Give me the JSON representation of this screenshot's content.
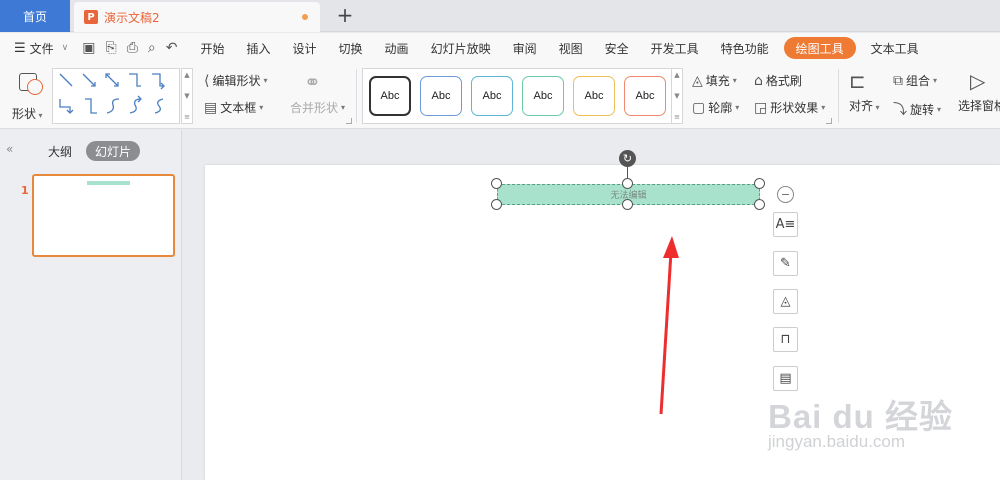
{
  "tabs": {
    "home": "首页",
    "doc_logo": "P",
    "doc_name": "演示文稿2",
    "new_tab": "+"
  },
  "menu": {
    "file": "文件",
    "items": [
      "开始",
      "插入",
      "设计",
      "切换",
      "动画",
      "幻灯片放映",
      "审阅",
      "视图",
      "安全",
      "开发工具",
      "特色功能",
      "绘图工具",
      "文本工具"
    ],
    "active_item": "绘图工具",
    "accent_color": "#ee7a34"
  },
  "ribbon": {
    "shape": "形状",
    "edit_shape": "编辑形状",
    "text_box": "文本框",
    "merge_shape": "合并形状",
    "style_samples": [
      "Abc",
      "Abc",
      "Abc",
      "Abc",
      "Abc",
      "Abc"
    ],
    "style_colors": [
      "#333333",
      "#6f9ad8",
      "#5fb6d8",
      "#6cc9a6",
      "#f0bf5a",
      "#ef8a70"
    ],
    "fill": "填充",
    "format_painter": "格式刷",
    "outline": "轮廓",
    "shape_effect": "形状效果",
    "align": "对齐",
    "group": "组合",
    "rotate": "旋转",
    "selection_pane": "选择窗格"
  },
  "left_panel": {
    "collapse": "«",
    "tab_outline": "大纲",
    "tab_slides": "幻灯片",
    "slide_number": "1"
  },
  "canvas": {
    "shape_text": "无法编辑",
    "shape_fill": "#a8e2cc",
    "annotation_color": "#ee2e2e"
  },
  "side_tools": [
    "text-style-icon",
    "brush-icon",
    "fill-bucket-icon",
    "outline-frame-icon",
    "text-frame-icon"
  ],
  "watermark": {
    "brand": "Bai du 经验",
    "url": "jingyan.baidu.com"
  }
}
